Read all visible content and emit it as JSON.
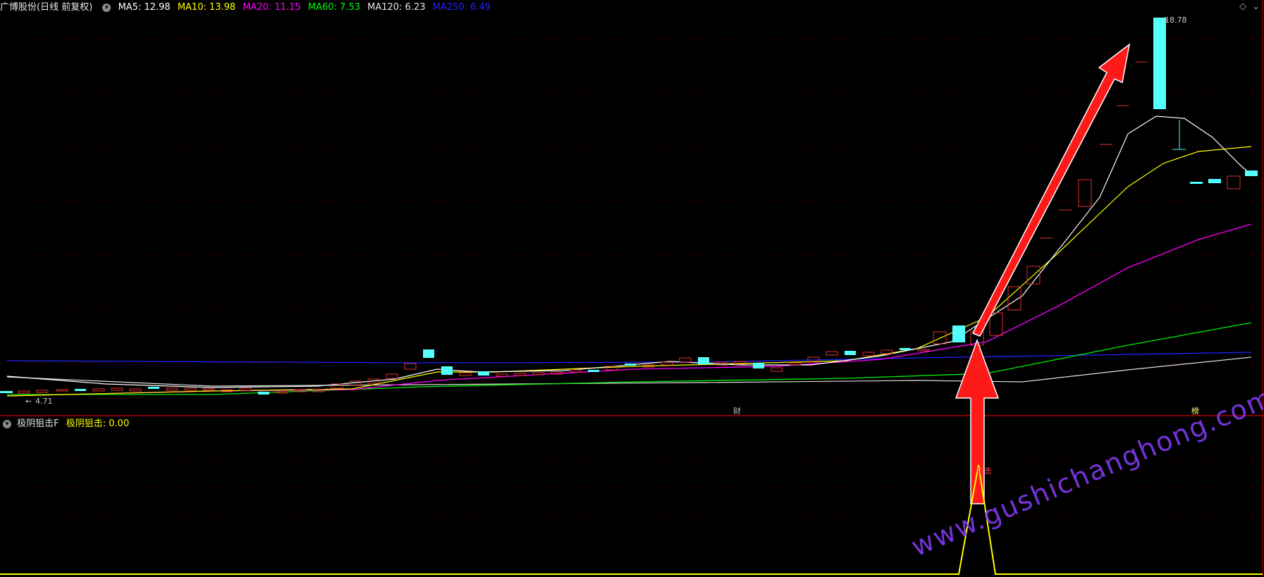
{
  "header": {
    "title": "广博股份(日线 前复权)",
    "ma5_label": "MA5: 12.98",
    "ma10_label": "MA10: 13.98",
    "ma20_label": "MA20: 11.15",
    "ma60_label": "MA60: 7.53",
    "ma120_label": "MA120: 6.23",
    "ma250_label": "MA250: 6.49",
    "colors": {
      "ma5": "#ffffff",
      "ma10": "#ffff00",
      "ma20": "#ff00ff",
      "ma60": "#00ff00",
      "ma120": "#e8e8e8",
      "ma250": "#2222ff"
    }
  },
  "price_chart": {
    "high_label": "18.78",
    "low_label": "4.71",
    "event_marker_1": "财",
    "event_marker_2": "榜",
    "up_color": "#e03030",
    "down_color": "#54ffff"
  },
  "indicator": {
    "name": "极阴狙击F",
    "value_label": "极阴狙击: 0.00",
    "signal_label": "狙击",
    "line_color": "#ffff00"
  },
  "watermark": "www.gushichanghong.com",
  "chart_data": {
    "type": "candlestick",
    "title": "广博股份(日线 前复权)",
    "price_high": 18.78,
    "price_low": 4.71,
    "moving_averages": [
      {
        "name": "MA5",
        "value": 12.98
      },
      {
        "name": "MA10",
        "value": 13.98
      },
      {
        "name": "MA20",
        "value": 11.15
      },
      {
        "name": "MA60",
        "value": 7.53
      },
      {
        "name": "MA120",
        "value": 6.23
      },
      {
        "name": "MA250",
        "value": 6.49
      }
    ],
    "indicator": {
      "name": "极阴狙击",
      "value": 0.0
    }
  }
}
